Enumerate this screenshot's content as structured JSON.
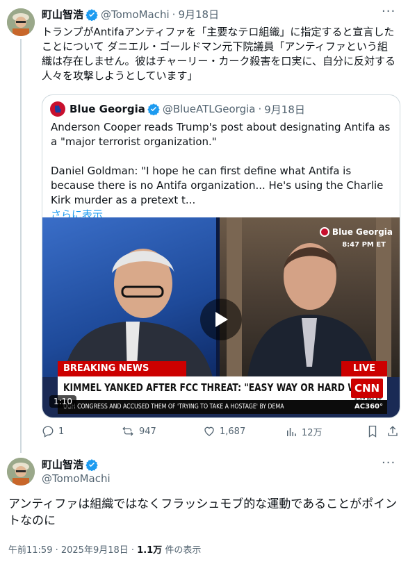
{
  "main_post": {
    "author_name": "町山智浩",
    "handle": "@TomoMachi",
    "date": "9月18日",
    "text": "トランプがAntifaアンティファを「主要なテロ組織」に指定すると宣言したことについて ダニエル・ゴールドマン元下院議員「アンティファという組織は存在しません。彼はチャーリー・カーク殺害を口実に、自分に反対する人々を攻撃しようとしています」",
    "more_label": "···"
  },
  "quote": {
    "author_name": "Blue Georgia",
    "handle": "@BlueATLGeorgia",
    "date": "9月18日",
    "paragraph1": "Anderson Cooper reads Trump's post about designating Antifa as a \"major terrorist organization.\"",
    "paragraph2": "Daniel Goldman: \"I hope he can first define what Antifa is because there is no Antifa organization... He's using the Charlie Kirk murder as a pretext t...",
    "show_more": "さらに表示"
  },
  "video": {
    "watermark": "Blue Georgia",
    "time_tag": "8:47 PM ET",
    "breaking": "BREAKING NEWS",
    "live": "LIVE",
    "headline": "KIMMEL YANKED AFTER FCC THREAT: \"EASY WAY OR HARD WAY\"",
    "network": "CNN",
    "network_time": "8:47 PM ET",
    "ticker": "UGH CONGRESS AND ACCUSED THEM OF 'TRYING TO TAKE A HOSTAGE' BY DEMA",
    "ticker_brand": "AC360°",
    "duration": "1:10"
  },
  "actions": {
    "replies": "1",
    "reposts": "947",
    "likes": "1,687",
    "views": "12万"
  },
  "reply_post": {
    "author_name": "町山智浩",
    "handle": "@TomoMachi",
    "text": "アンティファは組織ではなくフラッシュモブ的な運動であることがポイントなのに",
    "timestamp": "午前11:59 · 2025年9月18日 · ",
    "view_count": "1.1万",
    "view_label": " 件の表示",
    "more_label": "···"
  },
  "colors": {
    "verified_blue": "#1d9bf0",
    "secondary_text": "#536471",
    "cnn_red": "#cc0000"
  }
}
